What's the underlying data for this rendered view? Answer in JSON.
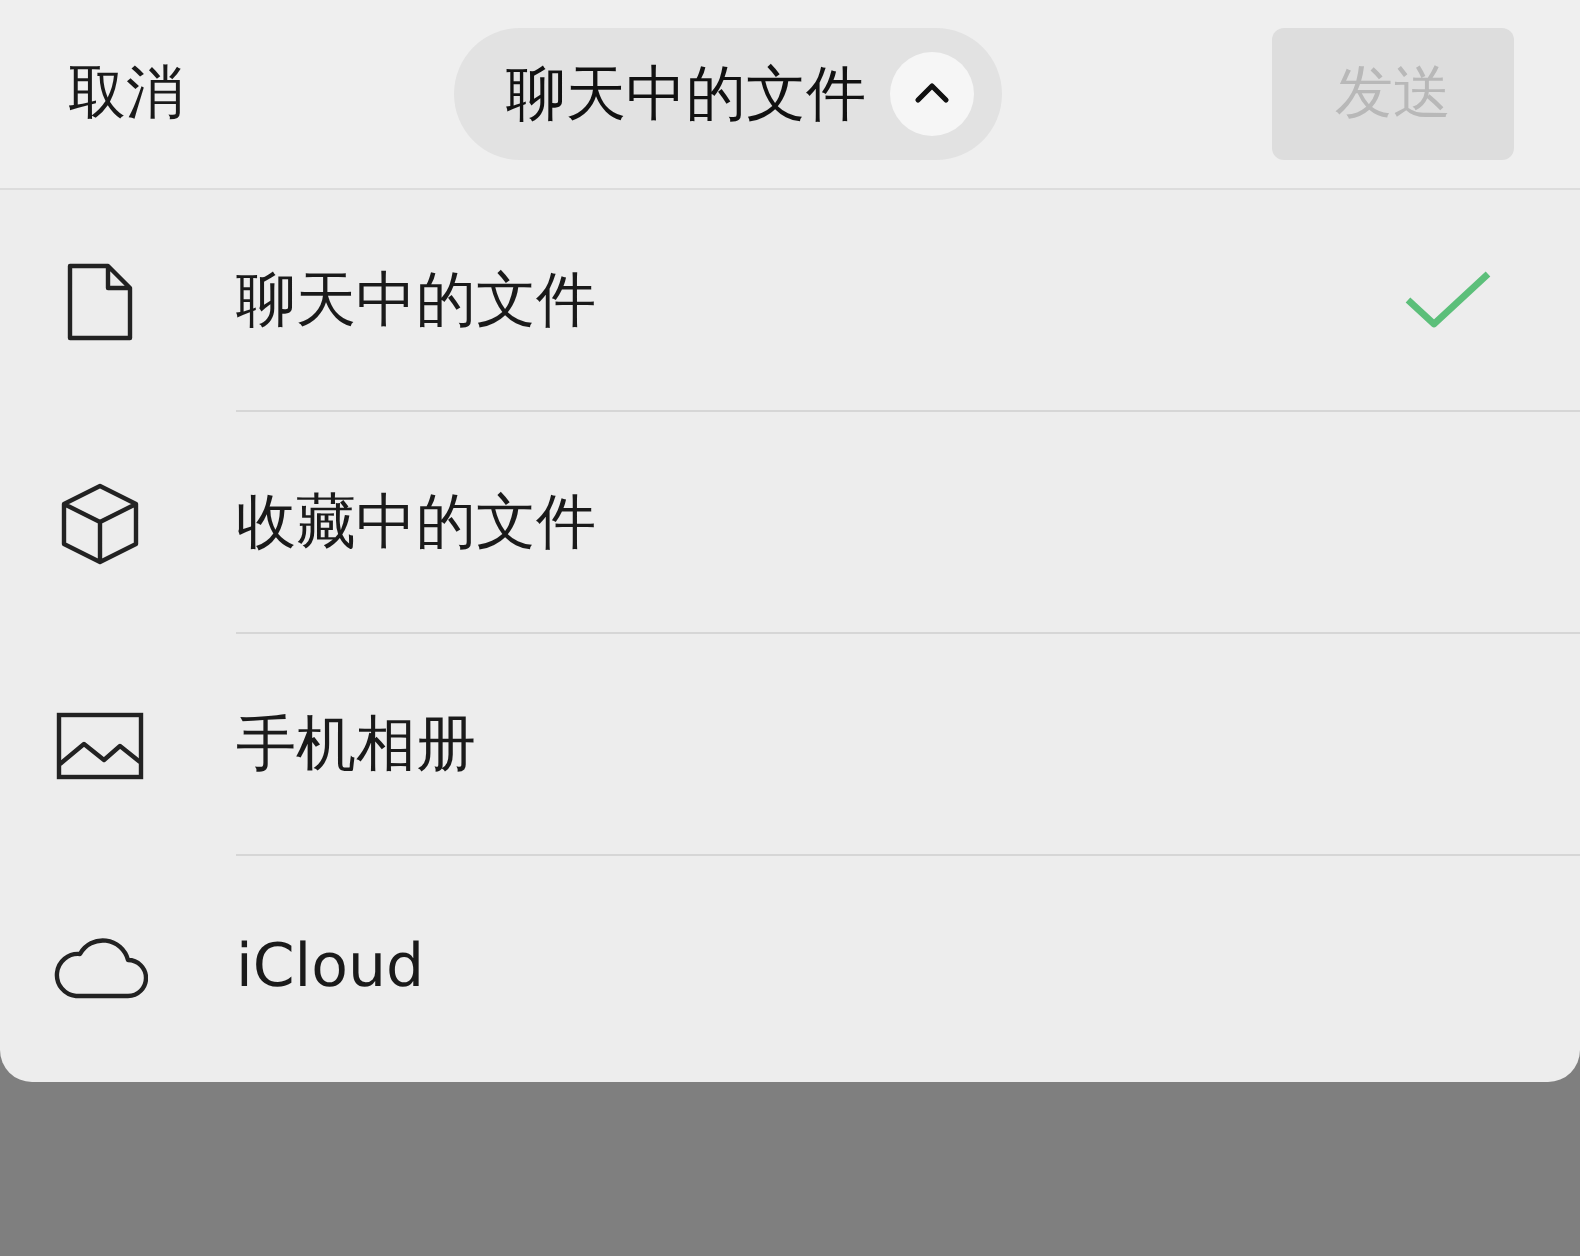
{
  "header": {
    "cancel": "取消",
    "title": "聊天中的文件",
    "expanded": true,
    "send": {
      "label": "发送",
      "disabled": true
    }
  },
  "sources": [
    {
      "kind": "file",
      "label": "聊天中的文件",
      "selected": true
    },
    {
      "kind": "cube",
      "label": "收藏中的文件",
      "selected": false
    },
    {
      "kind": "image",
      "label": "手机相册",
      "selected": false
    },
    {
      "kind": "cloud",
      "label": "iCloud",
      "selected": false
    }
  ]
}
